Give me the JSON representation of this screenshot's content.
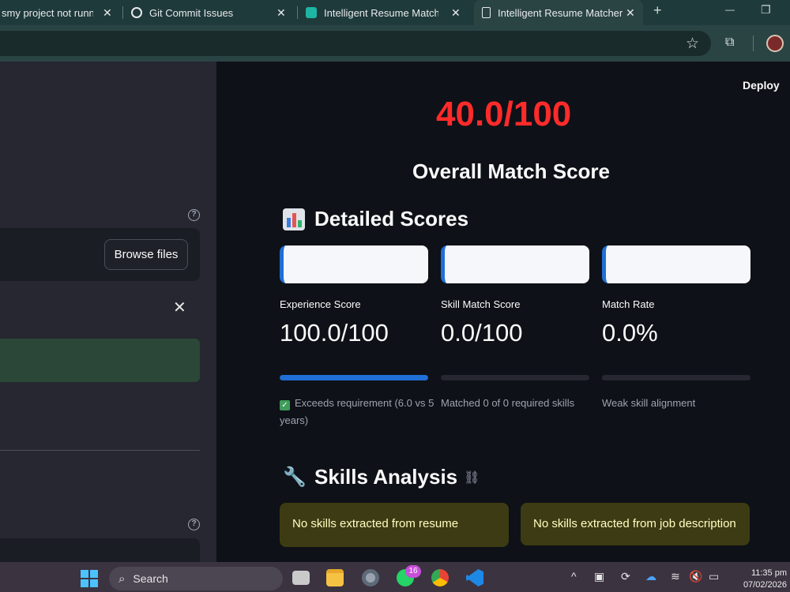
{
  "browser": {
    "tabs": [
      {
        "label": "smy project not running",
        "active": false
      },
      {
        "label": "Git Commit Issues",
        "active": false
      },
      {
        "label": "Intelligent Resume Matcher",
        "active": false
      },
      {
        "label": "Intelligent Resume Matcher",
        "active": true
      }
    ],
    "new_tab": "+",
    "minimize": "—",
    "restore": "❐"
  },
  "sidebar": {
    "browse_label": "Browse files"
  },
  "header": {
    "deploy_label": "Deploy"
  },
  "main": {
    "overall_score": "40.0/100",
    "overall_title": "Overall Match Score",
    "detailed_title": "Detailed Scores",
    "metrics": [
      {
        "label": "Experience Score",
        "value": "100.0/100",
        "progress": 100,
        "caption": "Exceeds requirement (6.0 vs 5 years)",
        "checked": true
      },
      {
        "label": "Skill Match Score",
        "value": "0.0/100",
        "progress": 0,
        "caption": "Matched 0 of 0 required skills",
        "checked": false
      },
      {
        "label": "Match Rate",
        "value": "0.0%",
        "progress": 0,
        "caption": "Weak skill alignment",
        "checked": false
      }
    ],
    "skills_title": "Skills Analysis",
    "warnings": [
      "No skills extracted from resume",
      "No skills extracted from job description"
    ]
  },
  "taskbar": {
    "search_label": "Search",
    "whatsapp_badge": "16",
    "time": "11:35 pm",
    "date": "07/02/2026"
  },
  "colors": {
    "accent": "#1f6fd6",
    "score_red": "#ff2b2b",
    "success_bg": "#2b4737",
    "warning_bg": "#3d3b13"
  }
}
